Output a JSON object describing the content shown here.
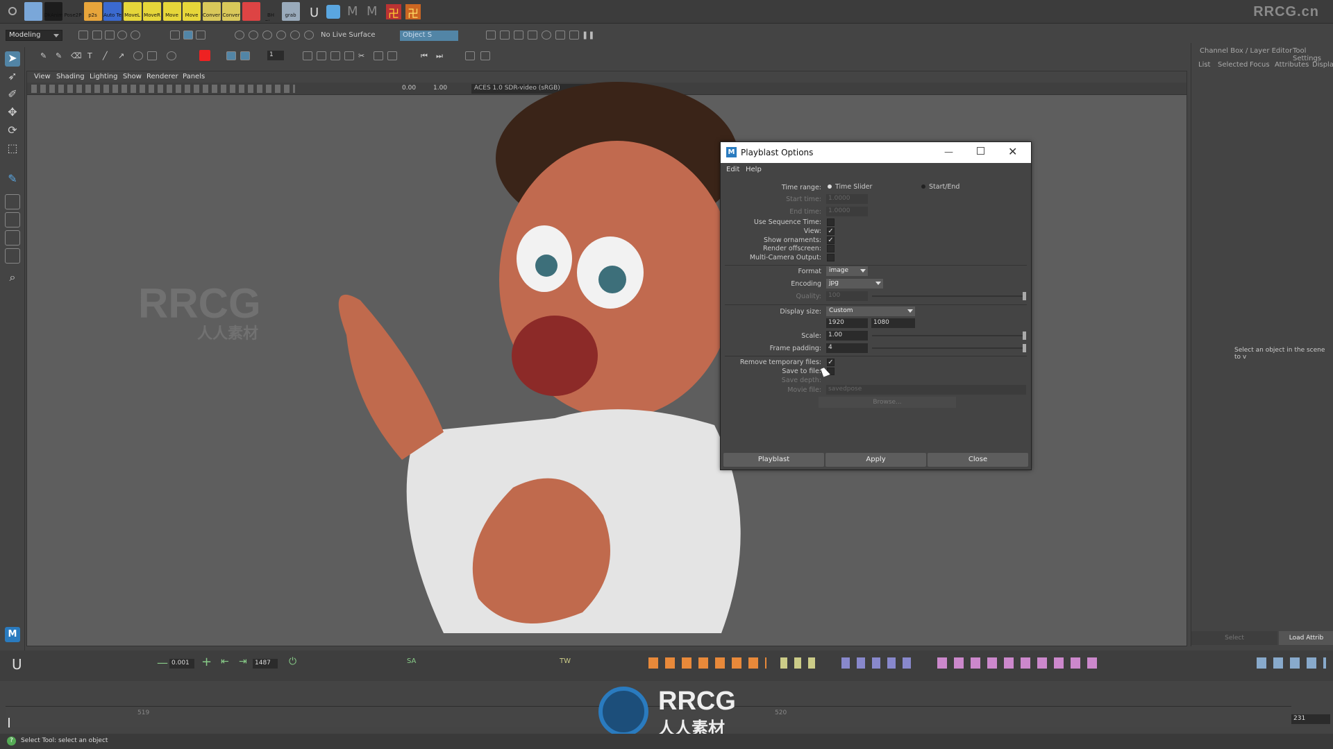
{
  "brand": "RRCG.cn",
  "shelf": {
    "icons": [
      {
        "label": "",
        "color": "#7aa7d9"
      },
      {
        "label": "DkAnim",
        "color": "#1c1c1c"
      },
      {
        "label": "Pose2P",
        "color": "#3c3c3c"
      },
      {
        "label": "p2s",
        "color": "#e8a53b"
      },
      {
        "label": "Auto Te",
        "color": "#3b6ad0"
      },
      {
        "label": "MoveL",
        "color": "#e6d63a"
      },
      {
        "label": "MoveR",
        "color": "#e6d63a"
      },
      {
        "label": "Move",
        "color": "#e6d63a"
      },
      {
        "label": "Move",
        "color": "#e6d63a"
      },
      {
        "label": "Conver",
        "color": "#d9c85a"
      },
      {
        "label": "Conver",
        "color": "#d9c85a"
      },
      {
        "label": "",
        "color": "#d44"
      },
      {
        "label": "BH Ghos",
        "color": "#3c3c3c"
      },
      {
        "label": "grab",
        "color": "#9ab"
      }
    ]
  },
  "statusline": {
    "menu_set": "Modeling",
    "live_surface": "No Live Surface",
    "object_field": "Object S",
    "frame_field": "1"
  },
  "viewport": {
    "menus": [
      "View",
      "Shading",
      "Lighting",
      "Show",
      "Renderer",
      "Panels"
    ],
    "exposure": "0.00",
    "gamma": "1.00",
    "color_space": "ACES 1.0 SDR-video (sRGB)"
  },
  "right_panel": {
    "header_tabs": [
      "Channel Box / Layer Editor",
      "Tool Settings"
    ],
    "menu": [
      "List",
      "Selected",
      "Focus",
      "Attributes",
      "Display"
    ],
    "empty_message": "Select an object in the scene to v",
    "bottom_buttons": [
      "Select",
      "Load Attrib"
    ]
  },
  "dialog": {
    "title": "Playblast Options",
    "menus": [
      "Edit",
      "Help"
    ],
    "time_range": {
      "label": "Time range:",
      "opt1": "Time Slider",
      "opt2": "Start/End"
    },
    "start_time": {
      "label": "Start time:",
      "value": "1.0000"
    },
    "end_time": {
      "label": "End time:",
      "value": "1.0000"
    },
    "use_sequence_time": {
      "label": "Use Sequence Time:",
      "checked": false
    },
    "view": {
      "label": "View:",
      "checked": true
    },
    "show_ornaments": {
      "label": "Show ornaments:",
      "checked": true
    },
    "render_offscreen": {
      "label": "Render offscreen:",
      "checked": false
    },
    "multi_camera": {
      "label": "Multi-Camera Output:",
      "checked": false
    },
    "format": {
      "label": "Format",
      "value": "image"
    },
    "encoding": {
      "label": "Encoding",
      "value": "jpg"
    },
    "quality": {
      "label": "Quality:",
      "value": "100",
      "level": 1.0
    },
    "display_size": {
      "label": "Display size:",
      "value": "Custom",
      "width": "1920",
      "height": "1080"
    },
    "scale": {
      "label": "Scale:",
      "value": "1.00",
      "level": 1.0
    },
    "frame_padding": {
      "label": "Frame padding:",
      "value": "4",
      "level": 1.0
    },
    "remove_temp": {
      "label": "Remove temporary files:",
      "checked": true
    },
    "save_to_file": {
      "label": "Save to file:",
      "checked": false
    },
    "save_depth": {
      "label": "Save depth:"
    },
    "movie_file": {
      "label": "Movie file:",
      "value": "savedpose"
    },
    "browse": "Browse...",
    "buttons": {
      "playblast": "Playblast",
      "apply": "Apply",
      "close": "Close"
    }
  },
  "timebar": {
    "step_value": "0.001",
    "frame_value": "1487",
    "marker_left": "519",
    "marker_right": "520",
    "current_frame": "231",
    "labels": {
      "sa": "SA",
      "tw": "TW"
    }
  },
  "helpline": "Select Tool: select an object",
  "watermark": {
    "latin": "RRCG",
    "cn": "人人素材"
  }
}
